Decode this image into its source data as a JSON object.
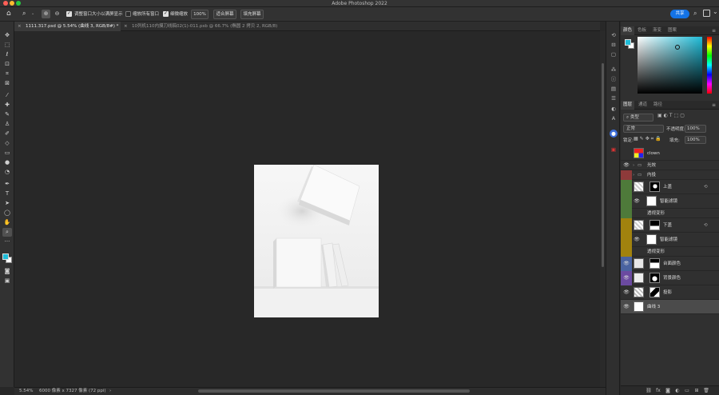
{
  "app_title": "Adobe Photoshop 2022",
  "share_label": "共享",
  "options": {
    "resize_windows_label": "调整窗口大小以满屏显示",
    "zoom_all_label": "缩放所有窗口",
    "scrubby_zoom_label": "细微缩放",
    "zoom_value": "100%",
    "fit_screen_label": "适合屏幕",
    "fill_screen_label": "填充屏幕"
  },
  "tabs": [
    {
      "label": "1111.317.psd @ 5.54% (曲线 3, RGB/8#) *"
    },
    {
      "label": "10列机110内摸刀线稿02(1)-011.psb @ 66.7% (椭圆 2 拷贝 2, RGB/8)"
    }
  ],
  "status": {
    "zoom": "5.54%",
    "doc_info": "6000 像素 x 7327 像素 (72 ppi)",
    "more": "›"
  },
  "color_panel": {
    "tabs": [
      "颜色",
      "色板",
      "渐变",
      "图案"
    ],
    "foreground": "#1fbcd8"
  },
  "layers_panel": {
    "tabs": [
      "图层",
      "通道",
      "路径"
    ],
    "filter_kind": "类型",
    "blend_mode": "正常",
    "opacity_label": "不透明度:",
    "opacity_value": "100%",
    "lock_label": "锁定:",
    "fill_label": "填充:",
    "fill_value": "100%"
  },
  "layers": [
    {
      "name": "clown",
      "color": ""
    },
    {
      "name": "光效",
      "color": ""
    },
    {
      "name": "内投",
      "color": "#8e3a3a"
    },
    {
      "name": "上盖",
      "color": "#4e7a3a"
    },
    {
      "name": "智能滤镜",
      "color": "#4e7a3a"
    },
    {
      "name": "透视变形",
      "color": "#4e7a3a"
    },
    {
      "name": "下盖",
      "color": "#a1820e"
    },
    {
      "name": "智能滤镜",
      "color": "#a1820e"
    },
    {
      "name": "透视变形",
      "color": "#a1820e"
    },
    {
      "name": "台面颜色",
      "color": "#4a63a0"
    },
    {
      "name": "背景颜色",
      "color": "#6b4aa0"
    },
    {
      "name": "投影",
      "color": ""
    },
    {
      "name": "曲线 3",
      "color": ""
    }
  ],
  "footer_icons": [
    "link-icon",
    "fx-icon",
    "mask-icon",
    "adjustment-icon",
    "group-icon",
    "new-layer-icon",
    "trash-icon"
  ],
  "footer_fx_label": "fx"
}
